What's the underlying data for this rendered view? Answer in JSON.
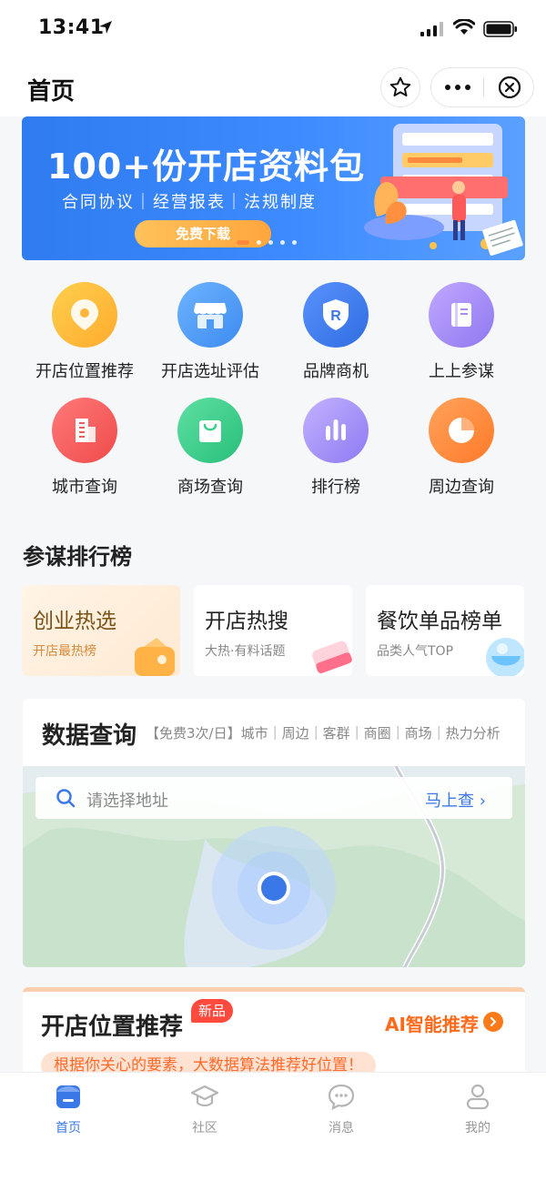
{
  "status": {
    "time": "13:41"
  },
  "nav": {
    "title": "首页"
  },
  "banner": {
    "title": "100+份开店资料包",
    "subtitle": "合同协议｜经营报表｜法规制度",
    "button": "免费下载"
  },
  "grid": [
    {
      "label": "开店位置推荐",
      "icon": "location-pin-icon",
      "color": "#ffbb33"
    },
    {
      "label": "开店选址评估",
      "icon": "storefront-icon",
      "color": "#4a9bf5"
    },
    {
      "label": "品牌商机",
      "icon": "brand-shield-icon",
      "color": "#3b78e7"
    },
    {
      "label": "上上参谋",
      "icon": "book-icon",
      "color": "#a98df5"
    },
    {
      "label": "城市查询",
      "icon": "building-icon",
      "color": "#f55a5a"
    },
    {
      "label": "商场查询",
      "icon": "shopping-bag-icon",
      "color": "#3fcf8e"
    },
    {
      "label": "排行榜",
      "icon": "bar-chart-icon",
      "color": "#a48ef5"
    },
    {
      "label": "周边查询",
      "icon": "pie-chart-icon",
      "color": "#ff8a3d"
    }
  ],
  "ranking": {
    "title": "参谋排行榜",
    "cards": [
      {
        "title": "创业热选",
        "sub": "开店最热榜"
      },
      {
        "title": "开店热搜",
        "sub": "大热·有料话题"
      },
      {
        "title": "餐饮单品榜单",
        "sub": "品类人气TOP"
      }
    ]
  },
  "data_query": {
    "title": "数据查询",
    "tags": "【免费3次/日】城市｜周边｜客群｜商圈｜商场｜热力分析",
    "search_placeholder": "请选择地址",
    "search_action": "马上查"
  },
  "recommend": {
    "title": "开店位置推荐",
    "badge": "新品",
    "ai_link": "AI智能推荐",
    "tip": "根据你关心的要素，大数据算法推荐好位置！"
  },
  "tabs": [
    {
      "label": "首页",
      "icon": "home-icon",
      "active": true
    },
    {
      "label": "社区",
      "icon": "graduation-cap-icon",
      "active": false
    },
    {
      "label": "消息",
      "icon": "chat-bubble-icon",
      "active": false
    },
    {
      "label": "我的",
      "icon": "person-icon",
      "active": false
    }
  ],
  "colors": {
    "primary": "#3b78e7",
    "accent": "#ff6a1a"
  }
}
